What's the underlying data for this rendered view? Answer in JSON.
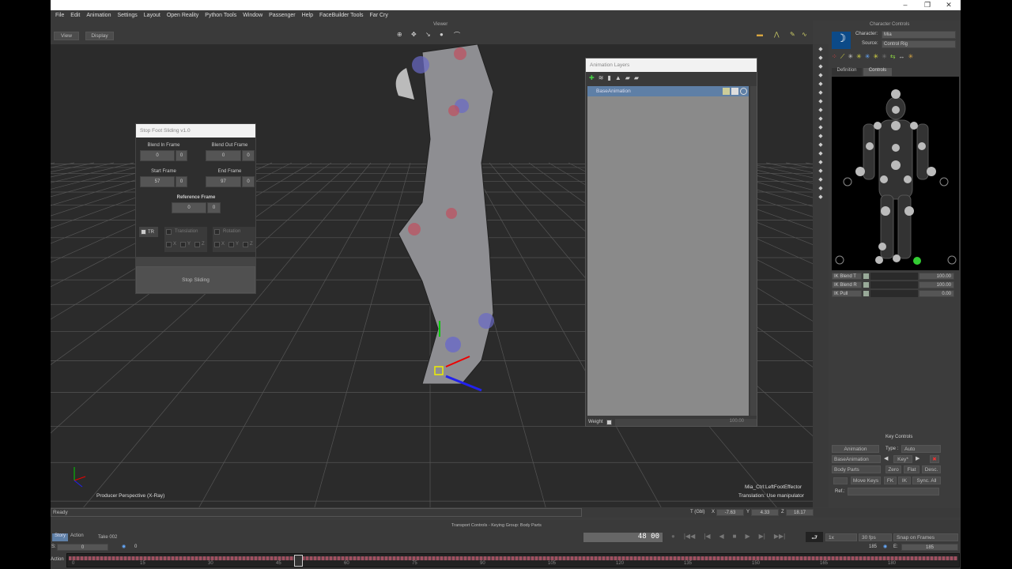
{
  "window": {
    "minimize": "–",
    "maximize": "❐",
    "close": "✕"
  },
  "menu": [
    "File",
    "Edit",
    "Animation",
    "Settings",
    "Layout",
    "Open Reality",
    "Python Tools",
    "Window",
    "Passenger",
    "Help",
    "FaceBuilder Tools",
    "Far Cry"
  ],
  "viewer": {
    "title": "Viewer",
    "view_btn": "View",
    "display_btn": "Display",
    "camera_label": "Producer Perspective (X-Ray)",
    "selection_name": "Mia_Ctrl:LeftFootEffector",
    "selection_hint": "Translation: Use manipulator"
  },
  "stop_foot_sliding": {
    "title": "Stop Foot Sliding v1.0",
    "blend_in_label": "Blend In Frame",
    "blend_in": "0",
    "blend_out_label": "Blend Out Frame",
    "blend_out": "0",
    "start_label": "Start Frame",
    "start": "57",
    "end_label": "End Frame",
    "end": "97",
    "ref_label": "Reference Frame",
    "ref": "0",
    "spin": "0",
    "tr_label": "TR",
    "translation_label": "Translation",
    "rotation_label": "Rotation",
    "x": "X",
    "y": "Y",
    "z": "Z",
    "stop_button": "Stop Sliding"
  },
  "anim_layers": {
    "title": "Animation Layers",
    "layer": "BaseAnimation",
    "weight_label": "Weight",
    "weight": "100.00"
  },
  "character_controls": {
    "title": "Character Controls",
    "character_label": "Character:",
    "character": "Mia",
    "source_label": "Source:",
    "source": "Control Rig",
    "tab_definition": "Definition",
    "tab_controls": "Controls",
    "ik": [
      {
        "name": "IK Blend T",
        "value": "100.00"
      },
      {
        "name": "IK Blend R",
        "value": "100.00"
      },
      {
        "name": "IK Pull",
        "value": "0.00"
      }
    ]
  },
  "key_controls": {
    "title": "Key Controls",
    "animation": "Animation",
    "type_label": "Type :",
    "type": "Auto",
    "layer": "BaseAnimation",
    "key": "Key*",
    "body_parts": "Body Parts",
    "zero": "Zero",
    "flat": "Flat",
    "desc": "Desc.",
    "move_keys": "Move Keys",
    "fk": "FK",
    "ik": "IK",
    "sync": "Sync. All",
    "ref_label": "Ref.:"
  },
  "status": {
    "text": "Ready",
    "t_label": "T (Gbl)",
    "x_label": "X",
    "x": "-7.63",
    "y_label": "Y",
    "y": "4.33",
    "z_label": "Z",
    "z": "18.17"
  },
  "transport": {
    "title": "Transport Controls  -  Keying Group: Body Parts",
    "story": "Story",
    "action": "Action",
    "take": "Take 002",
    "frame": "48",
    "frame_sub": "00",
    "speed": "1x",
    "fps": "30 fps",
    "snap": "Snap on Frames",
    "start_label": "S:",
    "start": "0",
    "start2": "0",
    "end_value": "185",
    "end_label": "E:",
    "end": "185",
    "timeline_label": "Action",
    "ticks": [
      "0",
      "15",
      "30",
      "45",
      "60",
      "75",
      "90",
      "105",
      "120",
      "135",
      "150",
      "165",
      "180"
    ]
  }
}
